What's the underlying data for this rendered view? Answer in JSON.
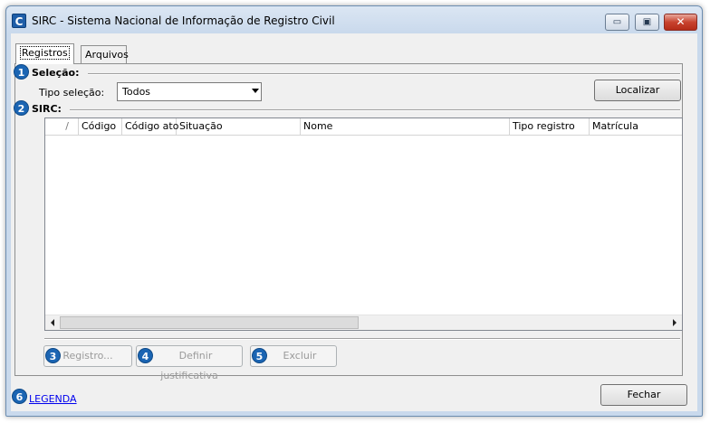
{
  "window": {
    "title": "SIRC - Sistema Nacional de Informação de Registro Civil",
    "app_icon_letter": "C",
    "minimize_glyph": "▭",
    "maximize_glyph": "▣",
    "close_glyph": "✕"
  },
  "tabs": [
    {
      "label": "Registros",
      "selected": true
    },
    {
      "label": "Arquivos",
      "selected": false
    }
  ],
  "badges": [
    "1",
    "2",
    "3",
    "4",
    "5",
    "6"
  ],
  "selecao": {
    "group_label": "Seleção:",
    "tipo_label": "Tipo seleção:",
    "tipo_value": "Todos",
    "localizar_label": "Localizar"
  },
  "sirc": {
    "group_label": "SIRC:",
    "sort_glyph": "/",
    "columns": [
      "Código",
      "Código ato",
      "Situação",
      "Nome",
      "Tipo registro",
      "Matrícula"
    ],
    "rows": []
  },
  "actions": {
    "registro_label": "Registro...",
    "definir_label": "Definir justificativa",
    "excluir_label": "Excluir"
  },
  "footer": {
    "legenda_label": "LEGENDA",
    "fechar_label": "Fechar"
  },
  "colors": {
    "badge": "#1b65b3",
    "close_button": "#c8432f",
    "link": "#0000ee"
  }
}
